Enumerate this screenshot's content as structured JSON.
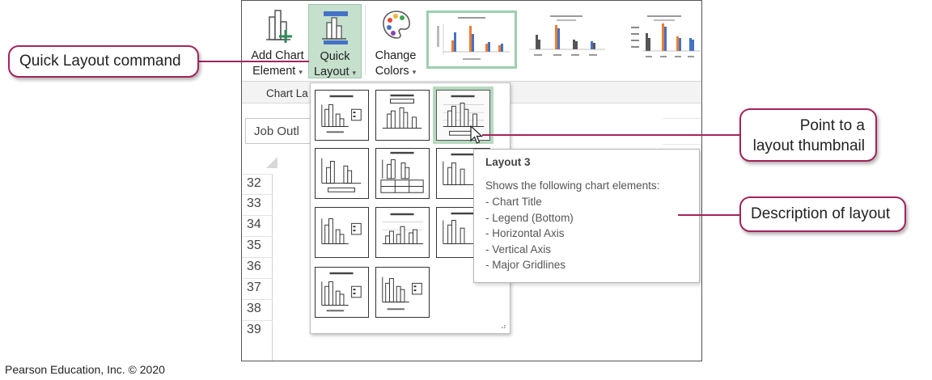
{
  "ribbon": {
    "add_chart": {
      "line1": "Add Chart",
      "line2": "Element",
      "icon": "add-chart-element-icon"
    },
    "quick_layout": {
      "line1": "Quick",
      "line2": "Layout",
      "icon": "quick-layout-icon"
    },
    "change_colors": {
      "line1": "Change",
      "line2": "Colors",
      "icon": "palette-icon"
    },
    "caret": "▾",
    "group_label": "Chart La"
  },
  "name_box": "Job Outl",
  "rows": [
    "32",
    "33",
    "34",
    "35",
    "36",
    "37",
    "38",
    "39"
  ],
  "gallery": {
    "selected_index": 2,
    "resize_glyph": "⠴"
  },
  "tooltip": {
    "title": "Layout 3",
    "description": "Shows the following chart elements:",
    "items": [
      "- Chart Title",
      "- Legend (Bottom)",
      "- Horizontal Axis",
      "- Vertical Axis",
      "- Major Gridlines"
    ]
  },
  "callouts": {
    "quick_layout": "Quick Layout command",
    "point_line1": "Point to a",
    "point_line2": "layout thumbnail",
    "description": "Description of layout"
  },
  "credit": "Pearson Education, Inc. © 2020",
  "colors": {
    "accent": "#a3245c",
    "highlight": "#c5e0cd",
    "bar_blue": "#4472c4",
    "bar_orange": "#ed7d31"
  }
}
